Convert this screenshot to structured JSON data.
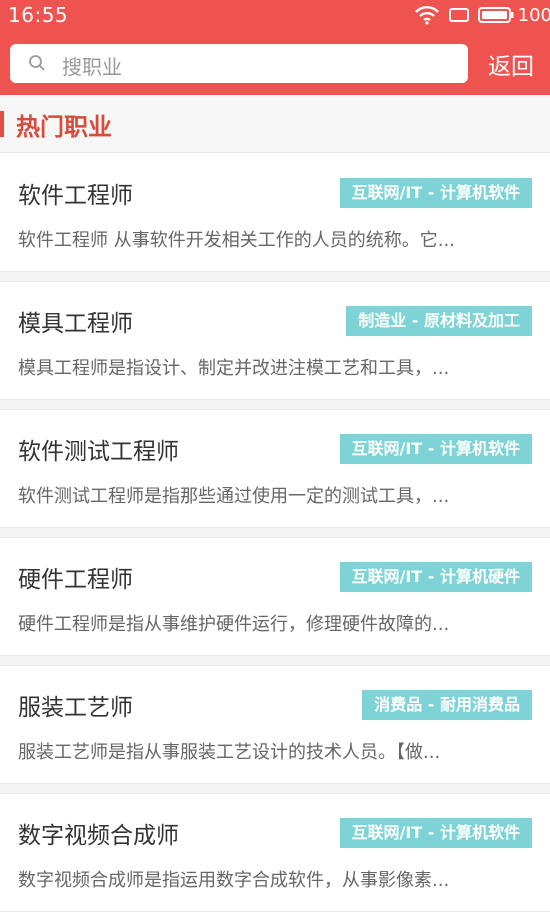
{
  "status": {
    "time": "16:55",
    "battery": "100"
  },
  "search": {
    "placeholder": "搜职业"
  },
  "header": {
    "back_label": "返回"
  },
  "section": {
    "title": "热门职业"
  },
  "careers": [
    {
      "name": "软件工程师",
      "tag": "互联网/IT - 计算机软件",
      "desc": "软件工程师 从事软件开发相关工作的人员的统称。它..."
    },
    {
      "name": "模具工程师",
      "tag": "制造业 - 原材料及加工",
      "desc": "模具工程师是指设计、制定并改进注模工艺和工具，..."
    },
    {
      "name": "软件测试工程师",
      "tag": "互联网/IT - 计算机软件",
      "desc": "软件测试工程师是指那些通过使用一定的测试工具，..."
    },
    {
      "name": "硬件工程师",
      "tag": "互联网/IT - 计算机硬件",
      "desc": "硬件工程师是指从事维护硬件运行，修理硬件故障的..."
    },
    {
      "name": "服装工艺师",
      "tag": "消费品 - 耐用消费品",
      "desc": "服装工艺师是指从事服装工艺设计的技术人员。【做..."
    },
    {
      "name": "数字视频合成师",
      "tag": "互联网/IT - 计算机软件",
      "desc": "数字视频合成师是指运用数字合成软件，从事影像素..."
    }
  ]
}
